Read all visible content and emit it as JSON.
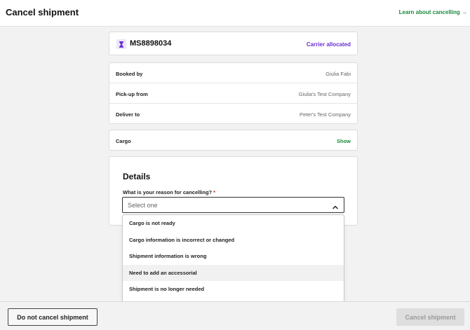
{
  "header": {
    "title": "Cancel shipment",
    "learn_link": "Learn about cancelling →"
  },
  "shipment": {
    "icon": "hourglass-icon",
    "id": "MS8898034",
    "status": "Carrier allocated"
  },
  "info": {
    "rows": [
      {
        "label": "Booked by",
        "value": "Giulia Fabi"
      },
      {
        "label": "Pick-up from",
        "value": "Giulia's Test Company"
      },
      {
        "label": "Deliver to",
        "value": "Peter's Test Company"
      }
    ]
  },
  "cargo": {
    "label": "Cargo",
    "action": "Show"
  },
  "details": {
    "title": "Details",
    "reason_label": "What is your reason for cancelling?",
    "required_mark": "*",
    "select_placeholder": "Select one",
    "options": [
      "Cargo is not ready",
      "Cargo information is incorrect or changed",
      "Shipment information is wrong",
      "Need to add an accessorial",
      "Shipment is no longer needed"
    ],
    "hovered_option_index": 3
  },
  "footer": {
    "keep_button": "Do not cancel shipment",
    "cancel_button": "Cancel shipment"
  },
  "colors": {
    "accent_green": "#1a8a3c",
    "status_purple": "#6a2fd6",
    "required_red": "#d21f1f"
  }
}
